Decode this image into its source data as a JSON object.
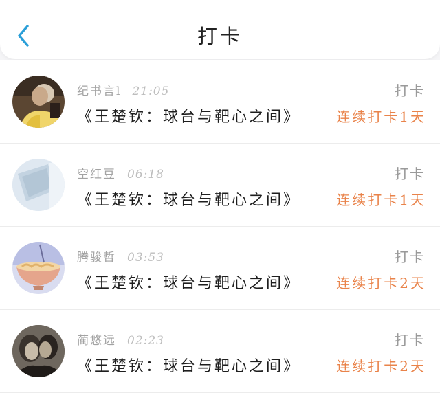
{
  "header": {
    "title": "打卡",
    "back_icon": "chevron-left-icon",
    "accent_color": "#2a9fd8"
  },
  "colors": {
    "streak": "#e9834a",
    "meta": "#a3a3a3"
  },
  "entries": [
    {
      "name": "纪书言l",
      "time": "21:05",
      "title": "《王楚钦：球台与靶心之间》",
      "label": "打卡",
      "streak": "连续打卡1天"
    },
    {
      "name": "空红豆",
      "time": "06:18",
      "title": "《王楚钦：球台与靶心之间》",
      "label": "打卡",
      "streak": "连续打卡1天"
    },
    {
      "name": "腾骏哲",
      "time": "03:53",
      "title": "《王楚钦：球台与靶心之间》",
      "label": "打卡",
      "streak": "连续打卡2天"
    },
    {
      "name": "蔺悠远",
      "time": "02:23",
      "title": "《王楚钦：球台与靶心之间》",
      "label": "打卡",
      "streak": "连续打卡2天"
    }
  ]
}
